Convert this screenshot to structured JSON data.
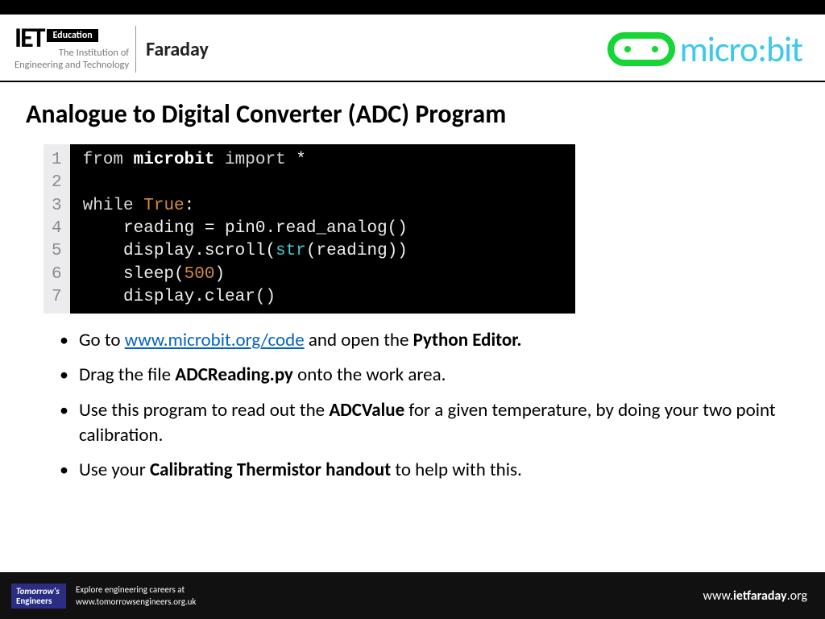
{
  "header": {
    "iet_education": "Education",
    "iet_subtitle_1": "The Institution of",
    "iet_subtitle_2": "Engineering and Technology",
    "faraday": "Faraday",
    "microbit_text": "micro:bit"
  },
  "slide": {
    "title": "Analogue to Digital Converter (ADC) Program"
  },
  "code": {
    "lines": [
      "1",
      "2",
      "3",
      "4",
      "5",
      "6",
      "7"
    ],
    "l1_from": "from ",
    "l1_mod": "microbit",
    "l1_import": " import ",
    "l1_star": "*",
    "l3_while": "while ",
    "l3_true": "True",
    "l3_colon": ":",
    "l4": "    reading = pin0.read_analog()",
    "l5_pre": "    display.scroll(",
    "l5_str": "str",
    "l5_post": "(reading))",
    "l6_pre": "    sleep(",
    "l6_num": "500",
    "l6_post": ")",
    "l7": "    display.clear()"
  },
  "instructions": {
    "i1_pre": "Go to ",
    "i1_link": "www.microbit.org/code",
    "i1_mid": " and open the ",
    "i1_bold": "Python Editor.",
    "i2_pre": "Drag the file ",
    "i2_bold": "ADCReading.py",
    "i2_post": " onto the work area.",
    "i3_pre": "Use this program to read out the ",
    "i3_bold": "ADCValue",
    "i3_post": " for a given temperature, by doing your two point calibration.",
    "i4_pre": "Use your ",
    "i4_bold": "Calibrating Thermistor handout",
    "i4_post": " to help with this."
  },
  "footer": {
    "te_tomorrows": "Tomorrow's",
    "te_engineers": "Engineers",
    "explore": "Explore engineering careers at",
    "te_url": "www.tomorrowsengineers.org.uk",
    "site_pre": "www.",
    "site_bold": "ietfaraday",
    "site_post": ".org"
  }
}
